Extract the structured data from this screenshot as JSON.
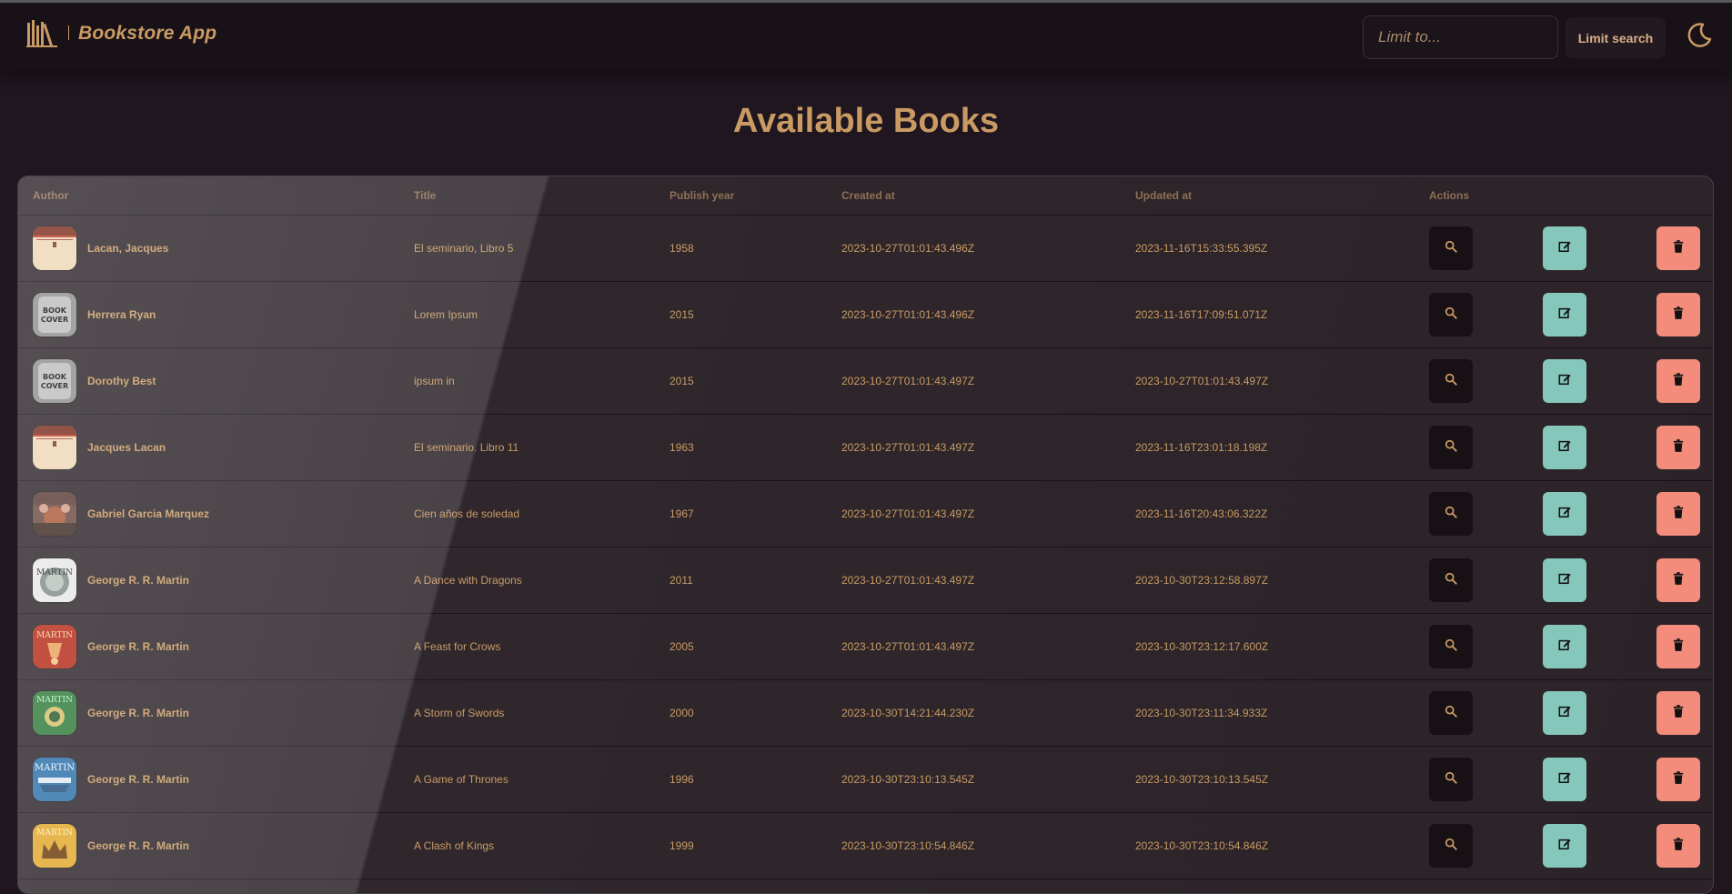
{
  "app": {
    "title": "Bookstore App",
    "brand_color": "#c99a63",
    "logo_icon": "books-icon"
  },
  "header": {
    "limit_placeholder": "Limit to...",
    "limit_button_label": "Limit search",
    "theme_toggle_icon": "moon-icon"
  },
  "page": {
    "title": "Available Books"
  },
  "table": {
    "columns": [
      "Author",
      "Title",
      "Publish year",
      "Created at",
      "Updated at",
      "Actions"
    ],
    "action_icons": [
      "search-icon",
      "edit-icon",
      "trash-icon"
    ],
    "action_colors": {
      "view": "#160f14",
      "edit": "#86c7bc",
      "delete": "#f48c7c"
    },
    "rows": [
      {
        "author": "Lacan, Jacques",
        "title": "El seminario, Libro 5",
        "year": "1958",
        "created": "2023-10-27T01:01:43.496Z",
        "updated": "2023-11-16T15:33:55.395Z",
        "cover": "lacan"
      },
      {
        "author": "Herrera Ryan",
        "title": "Lorem Ipsum",
        "year": "2015",
        "created": "2023-10-27T01:01:43.496Z",
        "updated": "2023-11-16T17:09:51.071Z",
        "cover": "placeholder"
      },
      {
        "author": "Dorothy Best",
        "title": "ipsum in",
        "year": "2015",
        "created": "2023-10-27T01:01:43.497Z",
        "updated": "2023-10-27T01:01:43.497Z",
        "cover": "placeholder"
      },
      {
        "author": "Jacques Lacan",
        "title": "El seminario. Libro 11",
        "year": "1963",
        "created": "2023-10-27T01:01:43.497Z",
        "updated": "2023-11-16T23:01:18.198Z",
        "cover": "lacan"
      },
      {
        "author": "Gabriel Garcia Marquez",
        "title": "Cien años de soledad",
        "year": "1967",
        "created": "2023-10-27T01:01:43.497Z",
        "updated": "2023-11-16T20:43:06.322Z",
        "cover": "marquez"
      },
      {
        "author": "George R. R. Martin",
        "title": "A Dance with Dragons",
        "year": "2011",
        "created": "2023-10-27T01:01:43.497Z",
        "updated": "2023-10-30T23:12:58.897Z",
        "cover": "dance"
      },
      {
        "author": "George R. R. Martin",
        "title": "A Feast for Crows",
        "year": "2005",
        "created": "2023-10-27T01:01:43.497Z",
        "updated": "2023-10-30T23:12:17.600Z",
        "cover": "feast"
      },
      {
        "author": "George R. R. Martin",
        "title": "A Storm of Swords",
        "year": "2000",
        "created": "2023-10-30T14:21:44.230Z",
        "updated": "2023-10-30T23:11:34.933Z",
        "cover": "storm"
      },
      {
        "author": "George R. R. Martin",
        "title": "A Game of Thrones",
        "year": "1996",
        "created": "2023-10-30T23:10:13.545Z",
        "updated": "2023-10-30T23:10:13.545Z",
        "cover": "game"
      },
      {
        "author": "George R. R. Martin",
        "title": "A Clash of Kings",
        "year": "1999",
        "created": "2023-10-30T23:10:54.846Z",
        "updated": "2023-10-30T23:10:54.846Z",
        "cover": "clash"
      }
    ]
  }
}
